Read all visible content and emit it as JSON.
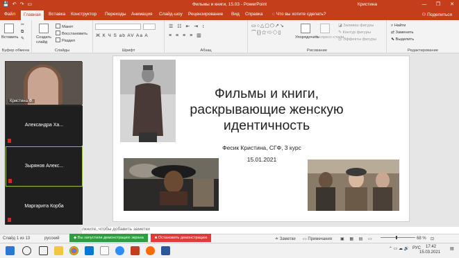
{
  "window": {
    "title": "Фильмы и книги, 15.03  -  PowerPoint",
    "user": "Кристина",
    "controls": [
      "—",
      "❐",
      "✕"
    ]
  },
  "quick_access": [
    "💾",
    "↶",
    "↷",
    "▭"
  ],
  "tabs": [
    "Файл",
    "Главная",
    "Вставка",
    "Конструктор",
    "Переходы",
    "Анимация",
    "Слайд-шоу",
    "Рецензирование",
    "Вид",
    "Справка"
  ],
  "tell_me": "Что вы хотите сделать?",
  "share_label": "Поделиться",
  "ribbon": {
    "groups": [
      "Буфер обмена",
      "Слайды",
      "Шрифт",
      "Абзац",
      "Рисование",
      "Редактирование"
    ],
    "paste": "Вставить",
    "create_slide": "Создать слайд",
    "layout": "Макет",
    "reset": "Восстановить",
    "section": "Раздел",
    "arrange": "Упорядочить",
    "express_styles": "Экспресс-стили",
    "shape_fill": "Заливка фигуры",
    "shape_outline": "Контур фигуры",
    "shape_effects": "Эффекты фигуры",
    "find": "Найти",
    "replace": "Заменить",
    "select": "Выделить",
    "font_buttons": "Ж  К  Ч  S  ab  AV  Aa  A"
  },
  "participants": [
    {
      "name": "Кристина Ф.",
      "video": true
    },
    {
      "name": "Александра  Ха...",
      "muted": true
    },
    {
      "name": "Зырянов  Алекс...",
      "muted": true,
      "highlighted": true
    },
    {
      "name": "Маргарита Корба",
      "muted": true
    }
  ],
  "slide": {
    "title": "Фильмы и книги, раскрывающие женскую идентичность",
    "author": "Фесик Кристина, СГФ, 3 курс",
    "date": "15.01.2021"
  },
  "notes_placeholder": "лкните, чтобы добавить заметки",
  "status": {
    "slide_counter": "Слайд 1 из 13",
    "language": "русский",
    "sharing_message": "Вы запустили демонстрацию экрана",
    "stop_sharing": "Остановить демонстрацию",
    "notes": "Заметки",
    "comments": "Примечания",
    "zoom": "68 %"
  },
  "taskbar": {
    "lang": "РУС",
    "time": "17:42",
    "date": "15.03.2021"
  },
  "colors": {
    "accent": "#c43e1c",
    "share_green": "#2e9c3f",
    "stop_red": "#e03b3b"
  }
}
